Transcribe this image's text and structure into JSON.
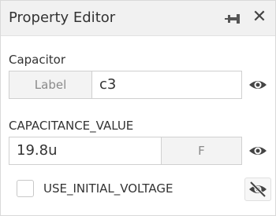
{
  "header": {
    "title": "Property Editor",
    "pin_icon": "pin-icon",
    "close_glyph": "✕"
  },
  "capacitor": {
    "section_label": "Capacitor",
    "label_caption": "Label",
    "label_value": "c3",
    "visibility_icon": "eye-icon"
  },
  "capacitance": {
    "section_label": "CAPACITANCE_VALUE",
    "value": "19.8u",
    "unit": "F",
    "visibility_icon": "eye-icon"
  },
  "initial_voltage": {
    "label": "USE_INITIAL_VOLTAGE",
    "checked": false,
    "visibility_icon": "eye-off-icon"
  },
  "colors": {
    "header_bg": "#f1f1f1",
    "field_border": "#d0d0d0",
    "caption_bg": "#f3f3f3",
    "icon": "#444444"
  }
}
